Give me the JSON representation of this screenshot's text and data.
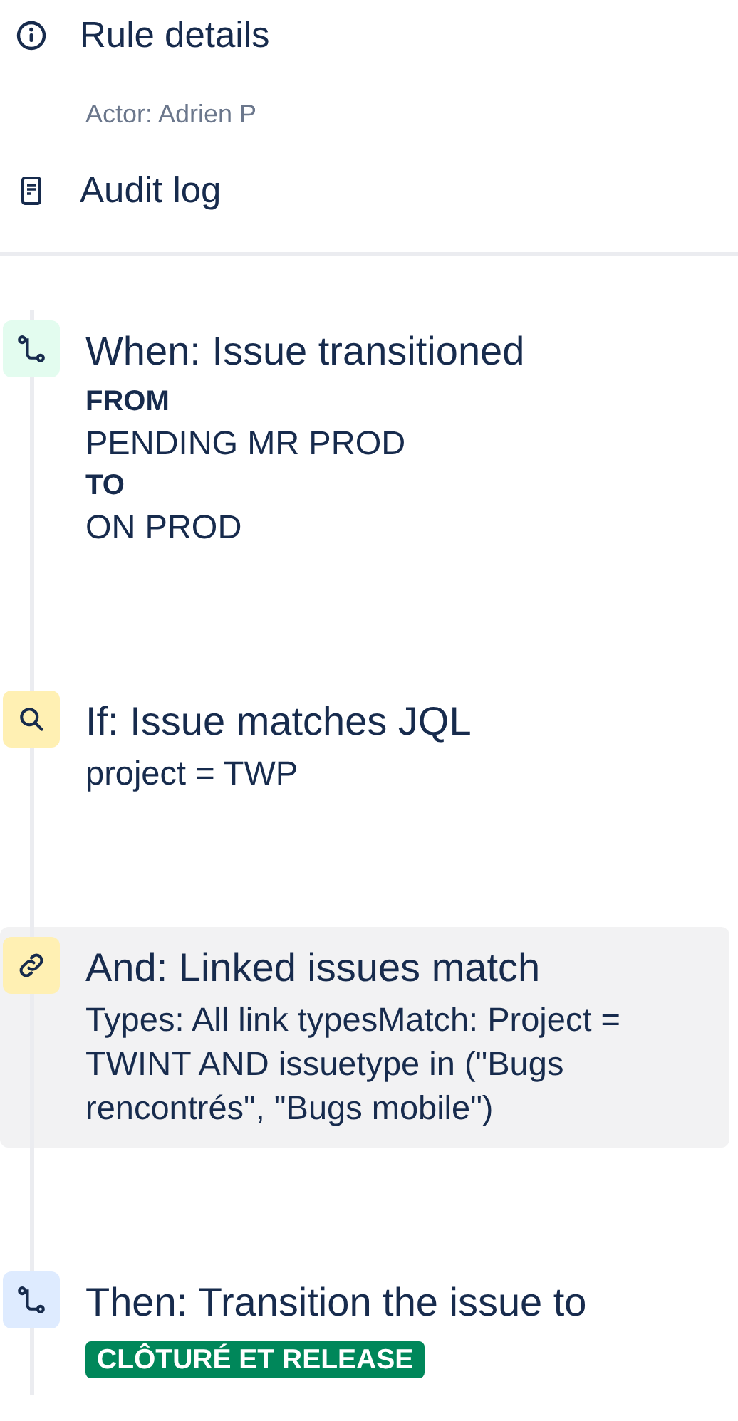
{
  "menu": [
    {
      "kind": "info",
      "label": "Rule details",
      "sub": "Actor: Adrien P"
    },
    {
      "kind": "log",
      "label": "Audit log"
    }
  ],
  "steps": [
    {
      "kind": "trigger",
      "title": "When: Issue transitioned",
      "highlighted": false,
      "lines": [
        {
          "kind": "label",
          "text": "FROM"
        },
        {
          "kind": "value",
          "text": "PENDING MR PROD"
        },
        {
          "kind": "label",
          "text": "TO"
        },
        {
          "kind": "value",
          "text": "ON PROD"
        }
      ]
    },
    {
      "kind": "condition",
      "title": "If: Issue matches JQL",
      "highlighted": false,
      "lines": [
        {
          "kind": "value",
          "text": "project = TWP"
        }
      ]
    },
    {
      "kind": "link-condition",
      "title": "And: Linked issues match",
      "highlighted": true,
      "lines": [
        {
          "kind": "value",
          "text": "Types: All link typesMatch: Project = TWINT AND issuetype in (\"Bugs rencontrés\", \"Bugs mobile\")"
        }
      ]
    },
    {
      "kind": "action",
      "title": "Then: Transition the issue to",
      "highlighted": false,
      "lines": [
        {
          "kind": "status",
          "text": "CLÔTURÉ ET RELEASE"
        }
      ]
    }
  ]
}
